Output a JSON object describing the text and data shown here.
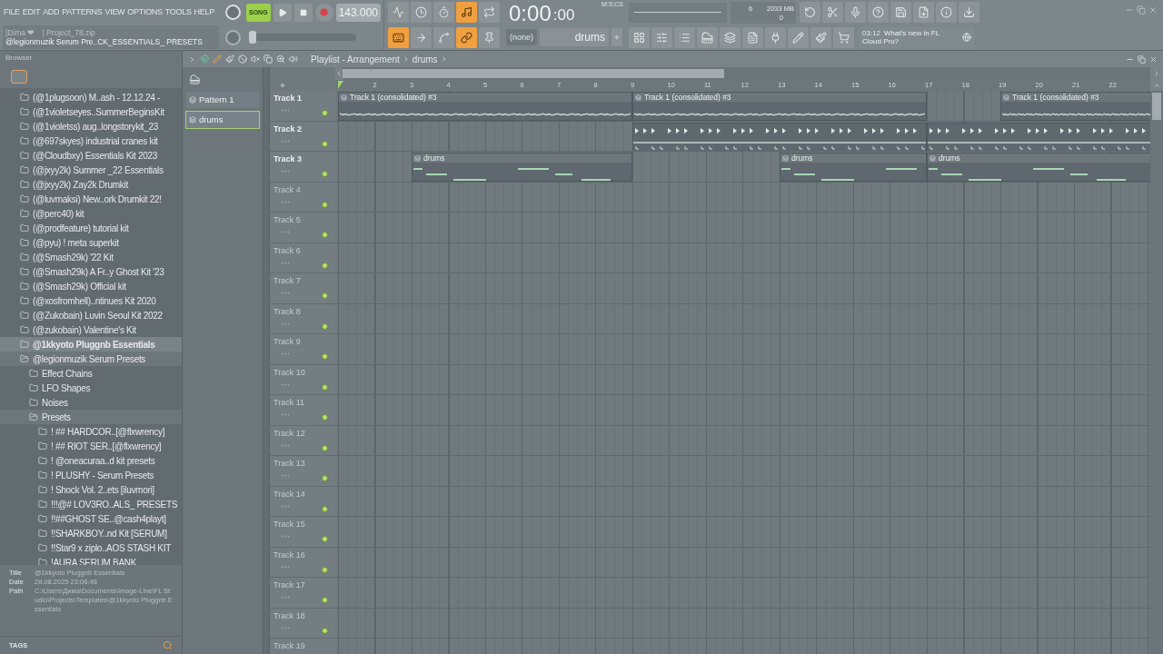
{
  "menu": [
    "FILE",
    "EDIT",
    "ADD",
    "PATTERNS",
    "VIEW",
    "OPTIONS",
    "TOOLS",
    "HELP"
  ],
  "hint": {
    "user": "|Dima ❤",
    "file": "| Project_78.zip",
    "text": "@legionmuzik Serum Pre..CK_ESSENTIALS_ PRESETS"
  },
  "transport": {
    "mode_label": "SONG",
    "song_mode": true,
    "tempo": "143.000",
    "time": "0:00",
    "time_cs": ":00",
    "time_unit": "M:S:CS"
  },
  "toggles_row1": [
    {
      "kind": "metronome",
      "on": false
    },
    {
      "kind": "wait",
      "on": false
    },
    {
      "kind": "countdown",
      "on": false
    },
    {
      "kind": "step",
      "on": true
    },
    {
      "kind": "loop",
      "on": false
    }
  ],
  "toggles_row2": [
    {
      "kind": "typing",
      "on": true
    },
    {
      "kind": "arrow",
      "on": false
    },
    {
      "kind": "curve",
      "on": false
    },
    {
      "kind": "link",
      "on": true
    },
    {
      "kind": "stamp",
      "on": false
    }
  ],
  "pitch": {
    "level": 0
  },
  "cpu": {
    "polyphony": "6",
    "memory": "2033 MB",
    "value": "0"
  },
  "pattern_selector": {
    "preset": "(none)",
    "pattern": "drums"
  },
  "news": {
    "time": "03:12",
    "text": "What's new in FL Cloud Pro?"
  },
  "browser": {
    "title": "Browser",
    "items": [
      {
        "name": "(@1plugsoon) M..ash - 12.12.24 -",
        "selected": false,
        "expanded": false
      },
      {
        "name": "(@1violetseyes..SummerBeginsKit",
        "selected": false,
        "expanded": false
      },
      {
        "name": "(@1violetss) aug..longstorykit_23",
        "selected": false,
        "expanded": false
      },
      {
        "name": "(@697skyes) industrial cranes kit",
        "selected": false,
        "expanded": false
      },
      {
        "name": "(@Cloudbxy) Essentials Kit 2023",
        "selected": false,
        "expanded": false
      },
      {
        "name": "(@jxyy2k) Summer _22 Essentials",
        "selected": false,
        "expanded": false
      },
      {
        "name": "(@jxyy2k) Zay2k Drumkit",
        "selected": false,
        "expanded": false
      },
      {
        "name": "(@luvmaksi) New..ork Drumkit 22!",
        "selected": false,
        "expanded": false
      },
      {
        "name": "(@perc40) kit",
        "selected": false,
        "expanded": false
      },
      {
        "name": "(@prodfeature) tutorial kit",
        "selected": false,
        "expanded": false
      },
      {
        "name": "(@pyu) ! meta superkit",
        "selected": false,
        "expanded": false
      },
      {
        "name": "(@Smash29k) '22 Kit",
        "selected": false,
        "expanded": false
      },
      {
        "name": "(@Smash29k) A Fr..y Ghost Kit '23",
        "selected": false,
        "expanded": false
      },
      {
        "name": "(@Smash29k) Official kit",
        "selected": false,
        "expanded": false
      },
      {
        "name": "(@xosfromhell)..ntinues Kit 2020",
        "selected": false,
        "expanded": false
      },
      {
        "name": "(@Zukobain) Luvin Seoul Kit 2022",
        "selected": false,
        "expanded": false
      },
      {
        "name": "(@zukobain) Valentine's Kit",
        "selected": false,
        "expanded": false
      },
      {
        "name": "@1kkyoto Pluggnb Essentials",
        "selected": true,
        "expanded": false
      },
      {
        "name": "@legionmuzik Serum Presets",
        "selected": false,
        "expanded": true,
        "children": [
          {
            "name": "Effect Chains",
            "selected": false,
            "expanded": false
          },
          {
            "name": "LFO Shapes",
            "selected": false,
            "expanded": false
          },
          {
            "name": "Noises",
            "selected": false,
            "expanded": false
          },
          {
            "name": "Presets",
            "selected": false,
            "expanded": true,
            "children": [
              {
                "name": "! ## HARDCOR..[@flxwrency]",
                "selected": false,
                "expanded": false
              },
              {
                "name": "! ## RIOT SER..[@flxwrency]",
                "selected": false,
                "expanded": false
              },
              {
                "name": "! @oneacuraa..d kit presets",
                "selected": false,
                "expanded": false
              },
              {
                "name": "! PLUSHY - Serum Presets",
                "selected": false,
                "expanded": false
              },
              {
                "name": "! Shock Vol. 2..ets [iluvmori]",
                "selected": false,
                "expanded": false
              },
              {
                "name": "!!!@# LOV3RO..ALS_ PRESETS",
                "selected": false,
                "expanded": false
              },
              {
                "name": "!!##GHOST SE..@cash4playt]",
                "selected": false,
                "expanded": false
              },
              {
                "name": "!!SHARKBOY..nd Kit [SERUM]",
                "selected": false,
                "expanded": false
              },
              {
                "name": "!!Star9 x ziplo..AOS STASH KIT",
                "selected": false,
                "expanded": false
              },
              {
                "name": "!AURA SERUM BANK",
                "selected": false,
                "expanded": false
              }
            ]
          }
        ]
      }
    ]
  },
  "info": {
    "title_label": "Title",
    "title": "@1kkyoto Pluggnb Essentials",
    "date_label": "Date",
    "date": "28.08.2025 23:06:48",
    "path_label": "Path",
    "path": "C:\\Users\\Дима\\Documents\\Image-Line\\FL Studio\\Projects\\Templates\\@1kkyoto Pluggnb Essentials"
  },
  "tags": "TAGS",
  "patterns": [
    {
      "name": "Pattern 1",
      "selected": false
    },
    {
      "name": "drums",
      "selected": true
    }
  ],
  "playlist": {
    "crumbs": [
      "Playlist - Arrangement",
      "drums"
    ],
    "bars": [
      "2",
      "3",
      "4",
      "5",
      "6",
      "7",
      "8",
      "9",
      "10",
      "11",
      "12",
      "13",
      "14",
      "15",
      "16",
      "17",
      "18",
      "19",
      "20",
      "21",
      "22"
    ],
    "tracks": [
      {
        "name": "Track 1",
        "cells": [
          {
            "kind": "audio",
            "start": true,
            "title": "Track 1 (consolidated) #3"
          },
          {
            "kind": "audio"
          },
          {
            "kind": "audio"
          },
          {
            "kind": "audio"
          },
          {
            "kind": "audio"
          },
          {
            "kind": "audio"
          },
          {
            "kind": "audio"
          },
          {
            "kind": "audio"
          },
          {
            "kind": "audio",
            "start": true,
            "title": "Track 1 (consolidated) #3"
          },
          {
            "kind": "audio"
          },
          {
            "kind": "audio"
          },
          {
            "kind": "audio"
          },
          {
            "kind": "audio"
          },
          {
            "kind": "audio"
          },
          {
            "kind": "audio"
          },
          {
            "kind": "audio"
          },
          {
            "kind": "empty"
          },
          {
            "kind": "empty"
          },
          {
            "kind": "audio",
            "start": true,
            "title": "Track 1 (consolidated) #3"
          },
          {
            "kind": "audio"
          },
          {
            "kind": "audio"
          },
          {
            "kind": "audio"
          }
        ]
      },
      {
        "name": "Track 2",
        "cells": [
          {
            "kind": "empty"
          },
          {
            "kind": "empty"
          },
          {
            "kind": "empty"
          },
          {
            "kind": "empty"
          },
          {
            "kind": "empty"
          },
          {
            "kind": "empty"
          },
          {
            "kind": "empty"
          },
          {
            "kind": "empty"
          },
          {
            "kind": "markers",
            "start": true
          },
          {
            "kind": "markers"
          },
          {
            "kind": "markers"
          },
          {
            "kind": "markers"
          },
          {
            "kind": "markers"
          },
          {
            "kind": "markers"
          },
          {
            "kind": "markers"
          },
          {
            "kind": "markers"
          },
          {
            "kind": "markers",
            "start": true
          },
          {
            "kind": "markers"
          },
          {
            "kind": "markers"
          },
          {
            "kind": "markers"
          },
          {
            "kind": "markers"
          },
          {
            "kind": "markers"
          }
        ]
      },
      {
        "name": "Track 3",
        "cells": [
          {
            "kind": "empty"
          },
          {
            "kind": "empty"
          },
          {
            "kind": "pattern",
            "start": true,
            "title": "drums"
          },
          {
            "kind": "pattern"
          },
          {
            "kind": "pattern"
          },
          {
            "kind": "pattern"
          },
          {
            "kind": "pattern"
          },
          {
            "kind": "pattern"
          },
          {
            "kind": "empty"
          },
          {
            "kind": "empty"
          },
          {
            "kind": "empty"
          },
          {
            "kind": "empty"
          },
          {
            "kind": "pattern",
            "start": true,
            "title": "drums"
          },
          {
            "kind": "pattern"
          },
          {
            "kind": "pattern"
          },
          {
            "kind": "pattern"
          },
          {
            "kind": "pattern",
            "start": true,
            "title": "drums"
          },
          {
            "kind": "pattern"
          },
          {
            "kind": "pattern"
          },
          {
            "kind": "pattern"
          },
          {
            "kind": "pattern"
          },
          {
            "kind": "pattern"
          }
        ]
      },
      {
        "name": "Track 4"
      },
      {
        "name": "Track 5"
      },
      {
        "name": "Track 6"
      },
      {
        "name": "Track 7"
      },
      {
        "name": "Track 8"
      },
      {
        "name": "Track 9"
      },
      {
        "name": "Track 10"
      },
      {
        "name": "Track 11"
      },
      {
        "name": "Track 12"
      },
      {
        "name": "Track 13"
      },
      {
        "name": "Track 14"
      },
      {
        "name": "Track 15"
      },
      {
        "name": "Track 16"
      },
      {
        "name": "Track 17"
      },
      {
        "name": "Track 18"
      },
      {
        "name": "Track 19"
      }
    ]
  }
}
